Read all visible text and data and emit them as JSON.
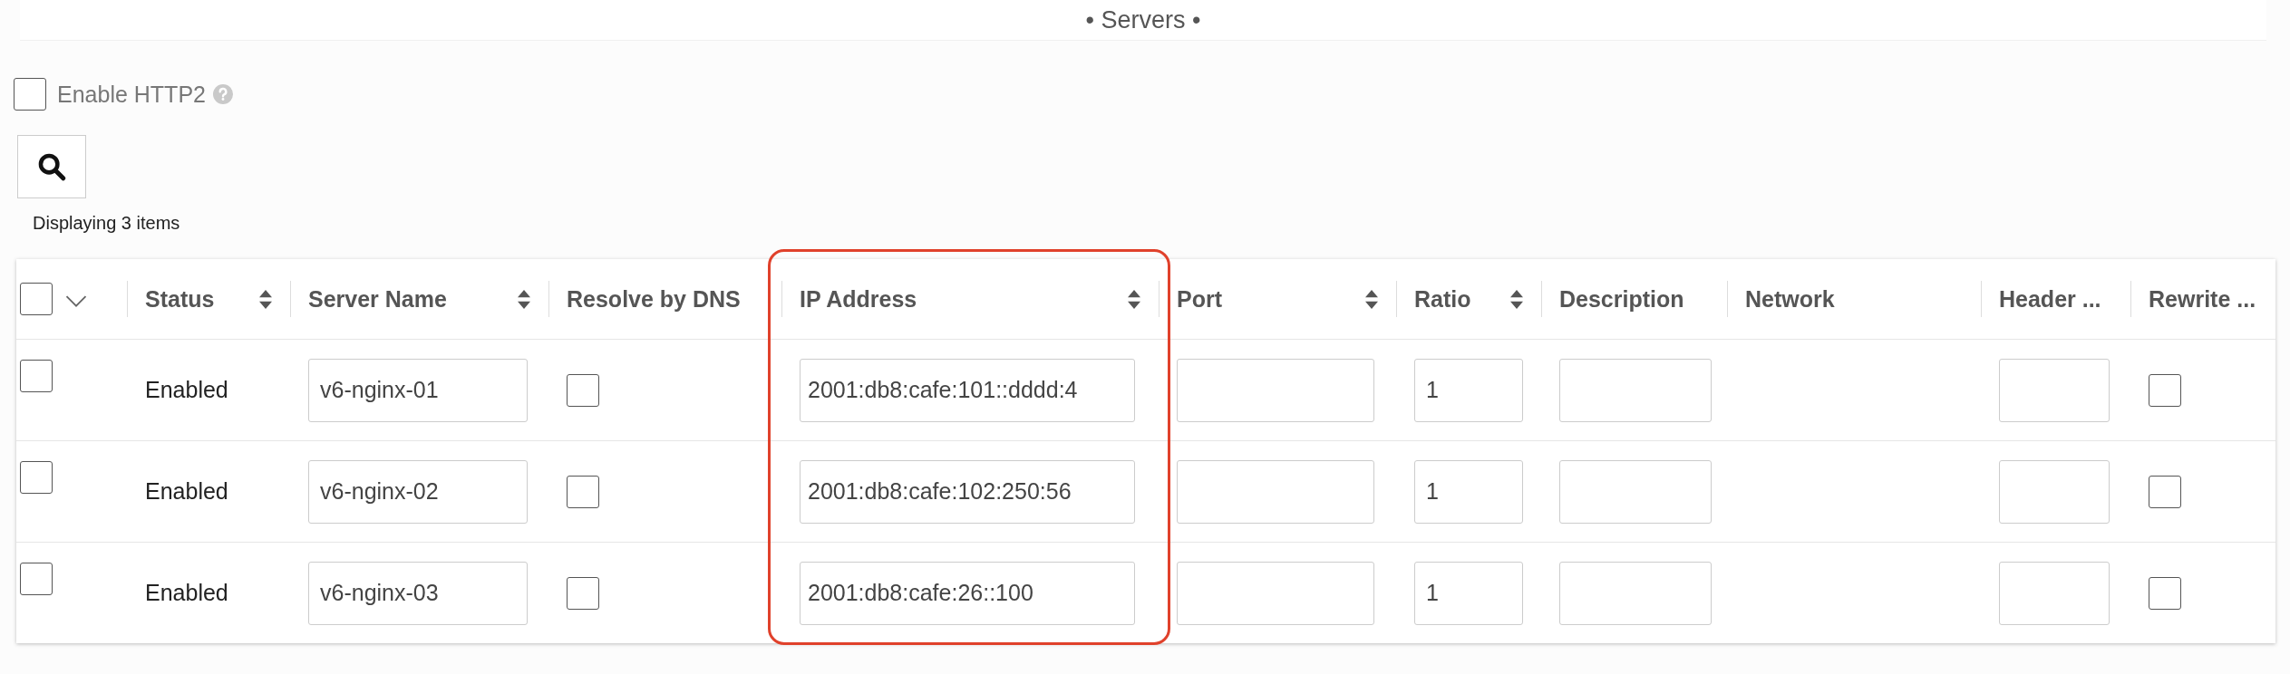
{
  "panel": {
    "title": "• Servers •"
  },
  "enable_http2": {
    "label": "Enable HTTP2",
    "checked": false
  },
  "item_count": "Displaying 3 items",
  "table": {
    "header_checkbox": {
      "checked": false
    },
    "columns": [
      {
        "label": "Status",
        "kind": "text",
        "sortable": true,
        "highlighted": false
      },
      {
        "label": "Server Name",
        "kind": "input",
        "sortable": true,
        "highlighted": false
      },
      {
        "label": "Resolve by DNS",
        "kind": "checkbox",
        "sortable": false,
        "highlighted": false
      },
      {
        "label": "IP Address",
        "kind": "input",
        "sortable": true,
        "highlighted": true
      },
      {
        "label": "Port",
        "kind": "input",
        "sortable": true,
        "highlighted": false
      },
      {
        "label": "Ratio",
        "kind": "input",
        "sortable": true,
        "highlighted": false
      },
      {
        "label": "Description",
        "kind": "input",
        "sortable": false,
        "highlighted": false
      },
      {
        "label": "Network",
        "kind": "none",
        "sortable": false,
        "highlighted": false
      },
      {
        "label": "Header ...",
        "kind": "input",
        "sortable": false,
        "highlighted": false
      },
      {
        "label": "Rewrite ...",
        "kind": "checkbox",
        "sortable": false,
        "highlighted": false
      }
    ],
    "rows": [
      {
        "selected": false,
        "cells": [
          {
            "text": "Enabled"
          },
          {
            "value": "v6-nginx-01"
          },
          {
            "checked": false
          },
          {
            "value": "2001:db8:cafe:101::dddd:4"
          },
          {},
          {
            "value": "1"
          },
          {},
          {},
          {},
          {
            "checked": false
          }
        ]
      },
      {
        "selected": false,
        "cells": [
          {
            "text": "Enabled"
          },
          {
            "value": "v6-nginx-02"
          },
          {
            "checked": false
          },
          {
            "value": "2001:db8:cafe:102:250:56"
          },
          {},
          {
            "value": "1"
          },
          {},
          {},
          {},
          {
            "checked": false
          }
        ]
      },
      {
        "selected": false,
        "cells": [
          {
            "text": "Enabled"
          },
          {
            "value": "v6-nginx-03"
          },
          {
            "checked": false
          },
          {
            "value": "2001:db8:cafe:26::100"
          },
          {},
          {
            "value": "1"
          },
          {},
          {},
          {},
          {
            "checked": false
          }
        ]
      }
    ]
  }
}
